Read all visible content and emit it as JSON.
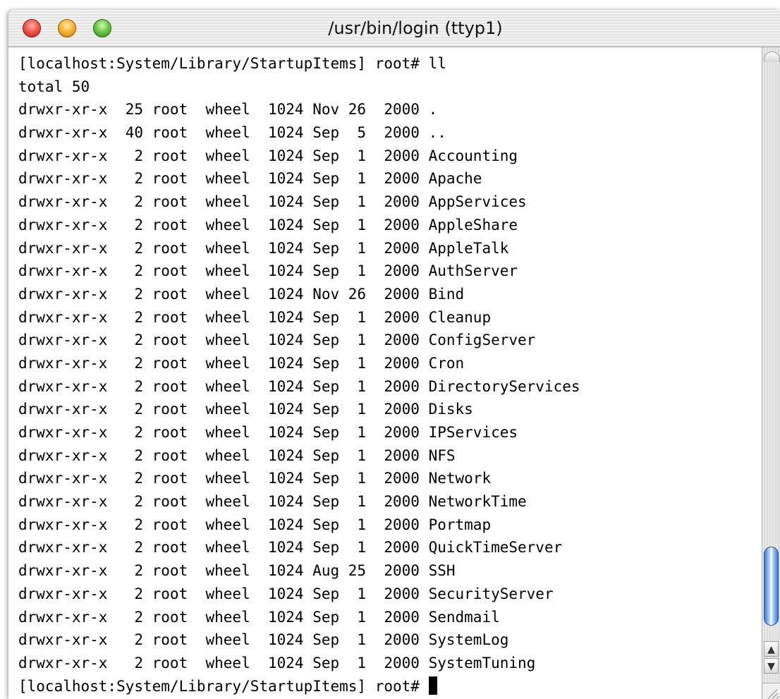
{
  "window": {
    "title": "/usr/bin/login  (ttyp1)"
  },
  "controls": {
    "close_icon": "close-icon",
    "minimize_icon": "minimize-icon",
    "zoom_icon": "zoom-icon"
  },
  "terminal": {
    "lines": [
      "[localhost:System/Library/StartupItems] root# ll",
      "total 50",
      "drwxr-xr-x  25 root  wheel  1024 Nov 26  2000 .",
      "drwxr-xr-x  40 root  wheel  1024 Sep  5  2000 ..",
      "drwxr-xr-x   2 root  wheel  1024 Sep  1  2000 Accounting",
      "drwxr-xr-x   2 root  wheel  1024 Sep  1  2000 Apache",
      "drwxr-xr-x   2 root  wheel  1024 Sep  1  2000 AppServices",
      "drwxr-xr-x   2 root  wheel  1024 Sep  1  2000 AppleShare",
      "drwxr-xr-x   2 root  wheel  1024 Sep  1  2000 AppleTalk",
      "drwxr-xr-x   2 root  wheel  1024 Sep  1  2000 AuthServer",
      "drwxr-xr-x   2 root  wheel  1024 Nov 26  2000 Bind",
      "drwxr-xr-x   2 root  wheel  1024 Sep  1  2000 Cleanup",
      "drwxr-xr-x   2 root  wheel  1024 Sep  1  2000 ConfigServer",
      "drwxr-xr-x   2 root  wheel  1024 Sep  1  2000 Cron",
      "drwxr-xr-x   2 root  wheel  1024 Sep  1  2000 DirectoryServices",
      "drwxr-xr-x   2 root  wheel  1024 Sep  1  2000 Disks",
      "drwxr-xr-x   2 root  wheel  1024 Sep  1  2000 IPServices",
      "drwxr-xr-x   2 root  wheel  1024 Sep  1  2000 NFS",
      "drwxr-xr-x   2 root  wheel  1024 Sep  1  2000 Network",
      "drwxr-xr-x   2 root  wheel  1024 Sep  1  2000 NetworkTime",
      "drwxr-xr-x   2 root  wheel  1024 Sep  1  2000 Portmap",
      "drwxr-xr-x   2 root  wheel  1024 Sep  1  2000 QuickTimeServer",
      "drwxr-xr-x   2 root  wheel  1024 Aug 25  2000 SSH",
      "drwxr-xr-x   2 root  wheel  1024 Sep  1  2000 SecurityServer",
      "drwxr-xr-x   2 root  wheel  1024 Sep  1  2000 Sendmail",
      "drwxr-xr-x   2 root  wheel  1024 Sep  1  2000 SystemLog",
      "drwxr-xr-x   2 root  wheel  1024 Sep  1  2000 SystemTuning"
    ],
    "prompt": "[localhost:System/Library/StartupItems] root# "
  },
  "scrollbar": {
    "up_arrow_icon": "arrow-up-icon",
    "down_arrow_icon": "arrow-down-icon",
    "up_glyph": "▲",
    "down_glyph": "▼",
    "thumb_color": "#3d7ad8",
    "scroll_position": 0.84
  },
  "colors": {
    "text": "#000000",
    "background": "#ffffff",
    "close": "#f25a4e",
    "minimize": "#f7b733",
    "zoom": "#6ec948"
  }
}
